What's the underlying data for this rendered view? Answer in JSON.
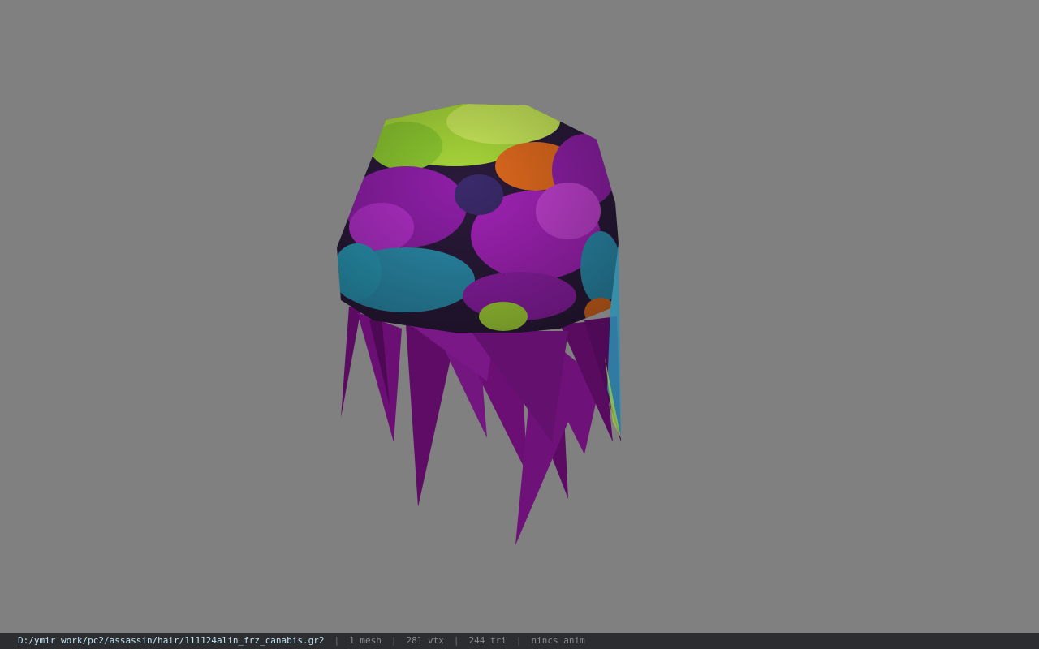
{
  "viewer": {
    "background_color": "#808080"
  },
  "model": {
    "icon": "hair-mesh-icon",
    "colors": {
      "hair_strands": "#6b0f74",
      "cap_purple": "#8f1fa8",
      "cap_green": "#a8d83a",
      "cap_teal": "#2c8fb0",
      "cap_orange": "#e06a1e"
    }
  },
  "status": {
    "path": "D:/ymir work/pc2/assassin/hair/111124alin_frz_canabis.gr2",
    "separator": "|",
    "mesh": "1 mesh",
    "vertices": "281 vtx",
    "triangles": "244 tri",
    "anim": "nincs anim"
  }
}
